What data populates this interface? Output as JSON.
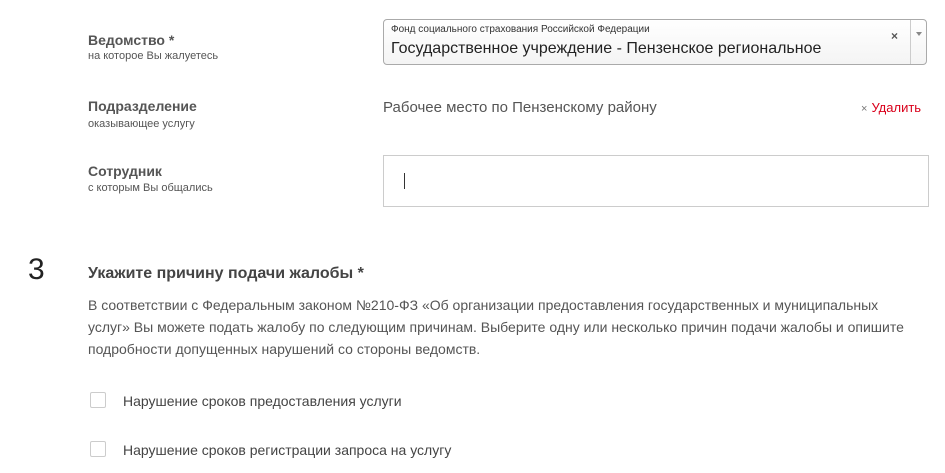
{
  "agency": {
    "label": "Ведомство *",
    "sublabel": "на которое Вы жалуетесь",
    "select_small": "Фонд социального страхования Российской Федерации",
    "select_value": "Государственное учреждение - Пензенское региональное",
    "clear_symbol": "×",
    "arrow_icon": "chevron-down-icon"
  },
  "subdivision": {
    "label": "Подразделение",
    "sublabel": "оказывающее услугу",
    "value": "Рабочее место по Пензенскому району",
    "remove_symbol": "×",
    "remove_label": "Удалить"
  },
  "employee": {
    "label": "Сотрудник",
    "sublabel": "с которым Вы общались",
    "value": ""
  },
  "reason_section": {
    "step": "3",
    "title": "Укажите причину подачи жалобы *",
    "description": "В соответствии с Федеральным законом №210-ФЗ «Об организации предоставления государственных и муниципальных услуг» Вы можете подать жалобу по следующим причинам. Выберите одну или несколько причин подачи жалобы и опишите подробности допущенных нарушений со стороны ведомств.",
    "reasons": [
      {
        "label": "Нарушение сроков предоставления услуги",
        "checked": false
      },
      {
        "label": "Нарушение сроков регистрации запроса на услугу",
        "checked": false
      }
    ]
  },
  "colors": {
    "remove_link": "#d9001b",
    "label_text": "#555555",
    "border": "#cccccc"
  }
}
